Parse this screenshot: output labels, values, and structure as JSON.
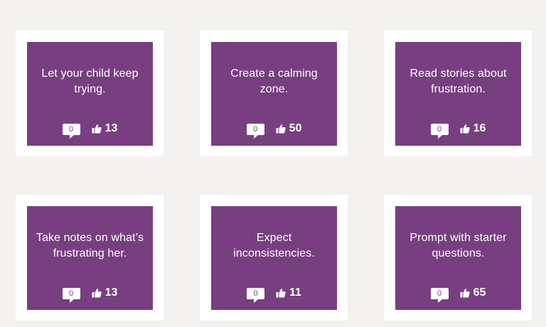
{
  "colors": {
    "background": "#f3f2f0",
    "frame": "#ffffff",
    "card": "#783f80"
  },
  "cards": [
    {
      "title": "Let your child keep trying.",
      "comments": "0",
      "likes": "13",
      "comment_icon": "comment-icon",
      "like_icon": "thumbs-up-icon"
    },
    {
      "title": "Create a calming zone.",
      "comments": "0",
      "likes": "50",
      "comment_icon": "comment-icon",
      "like_icon": "thumbs-up-icon"
    },
    {
      "title": "Read stories about frustration.",
      "comments": "0",
      "likes": "16",
      "comment_icon": "comment-icon",
      "like_icon": "thumbs-up-icon"
    },
    {
      "title": "Take notes on what’s frustrating her.",
      "comments": "0",
      "likes": "13",
      "comment_icon": "comment-icon",
      "like_icon": "thumbs-up-icon"
    },
    {
      "title": "Expect inconsistencies.",
      "comments": "0",
      "likes": "11",
      "comment_icon": "comment-icon",
      "like_icon": "thumbs-up-icon"
    },
    {
      "title": "Prompt with starter questions.",
      "comments": "0",
      "likes": "65",
      "comment_icon": "comment-icon",
      "like_icon": "thumbs-up-icon"
    }
  ]
}
